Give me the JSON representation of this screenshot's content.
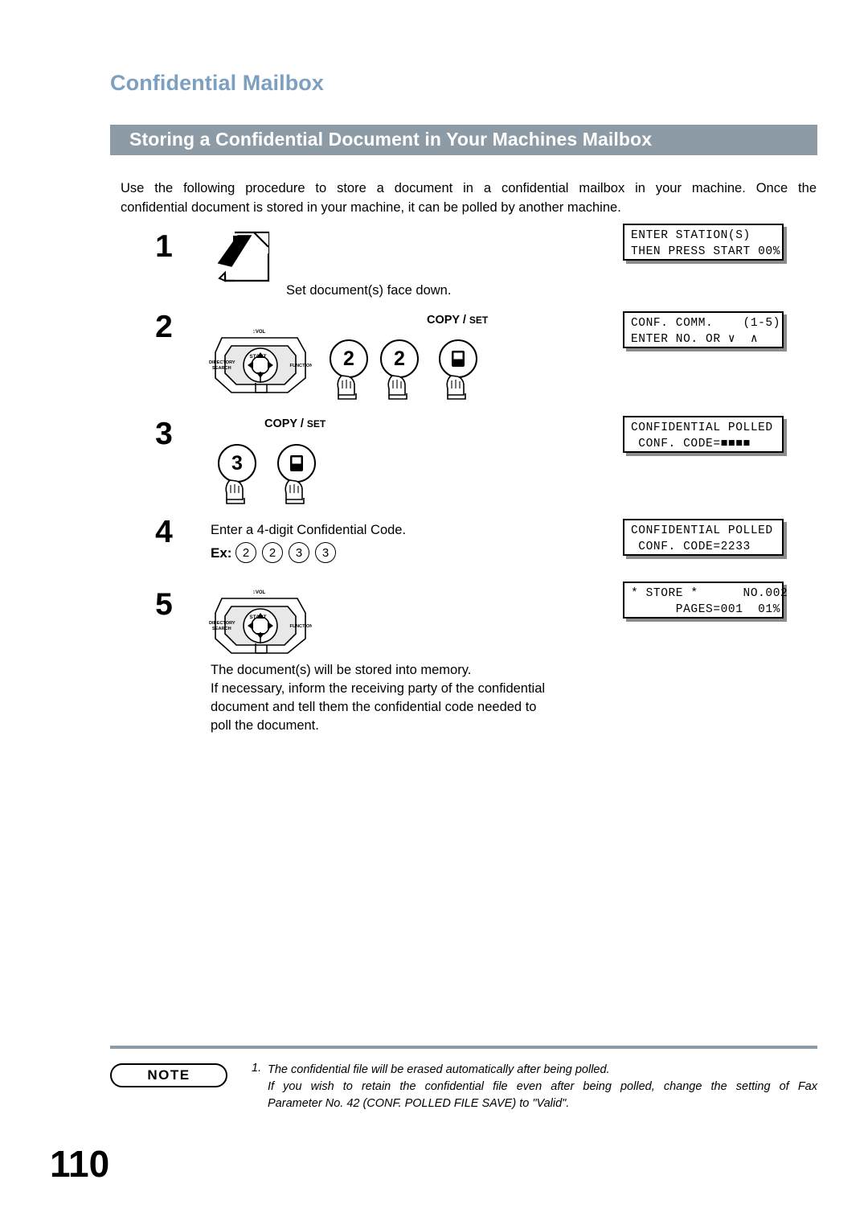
{
  "header": {
    "chapter_title": "Confidential Mailbox",
    "section_title": "Storing a Confidential Document in Your Machines Mailbox"
  },
  "intro": {
    "line1": "Use the following procedure to store a document in a confidential mailbox in your machine.  Once the",
    "line2": "confidential document is stored in your machine, it can be polled by another machine."
  },
  "steps": [
    {
      "number": "1",
      "caption": "Set document(s) face down.",
      "lcd": {
        "line1": "ENTER STATION(S)",
        "line2": "THEN PRESS START 00%"
      }
    },
    {
      "number": "2",
      "caption": "",
      "lcd": {
        "line1": "CONF. COMM.    (1-5)",
        "line2": "ENTER NO. OR ∨  ∧"
      },
      "keys": [
        "2",
        "2"
      ],
      "copyset_label": {
        "copy": "COPY /",
        "set": "SET"
      }
    },
    {
      "number": "3",
      "caption": "",
      "lcd": {
        "line1": "CONFIDENTIAL POLLED",
        "line2": " CONF. CODE=■■■■"
      },
      "keys": [
        "3"
      ],
      "copyset_label": {
        "copy": "COPY /",
        "set": "SET"
      }
    },
    {
      "number": "4",
      "caption": "Enter a 4-digit Confidential Code.",
      "example_label": "Ex:",
      "example_digits": [
        "2",
        "2",
        "3",
        "3"
      ],
      "lcd": {
        "line1": "CONFIDENTIAL POLLED",
        "line2": " CONF. CODE=2233"
      }
    },
    {
      "number": "5",
      "caption_lines": [
        "The document(s) will be stored into memory.",
        "If necessary, inform the receiving party of the confidential",
        "document and tell them the confidential code needed to",
        "poll the document."
      ],
      "lcd": {
        "line1": "* STORE *      NO.002",
        "line2": "      PAGES=001  01%"
      }
    }
  ],
  "panel_labels": {
    "vol": "VOL",
    "directory": "DIRECTORY",
    "search": "SEARCH",
    "start": "START",
    "function": "FUNCTION"
  },
  "note": {
    "badge": "NOTE",
    "item_number": "1.",
    "line1": "The confidential file will be erased automatically after being polled.",
    "line2": "If you wish to retain the confidential file even after being polled, change the setting of Fax",
    "line3": "Parameter No. 42 (CONF. POLLED FILE SAVE) to \"Valid\"."
  },
  "footer": {
    "page_number": "110"
  },
  "colors": {
    "chapter_blue": "#7d9fc0",
    "bar_gray": "#8c9ba5"
  }
}
